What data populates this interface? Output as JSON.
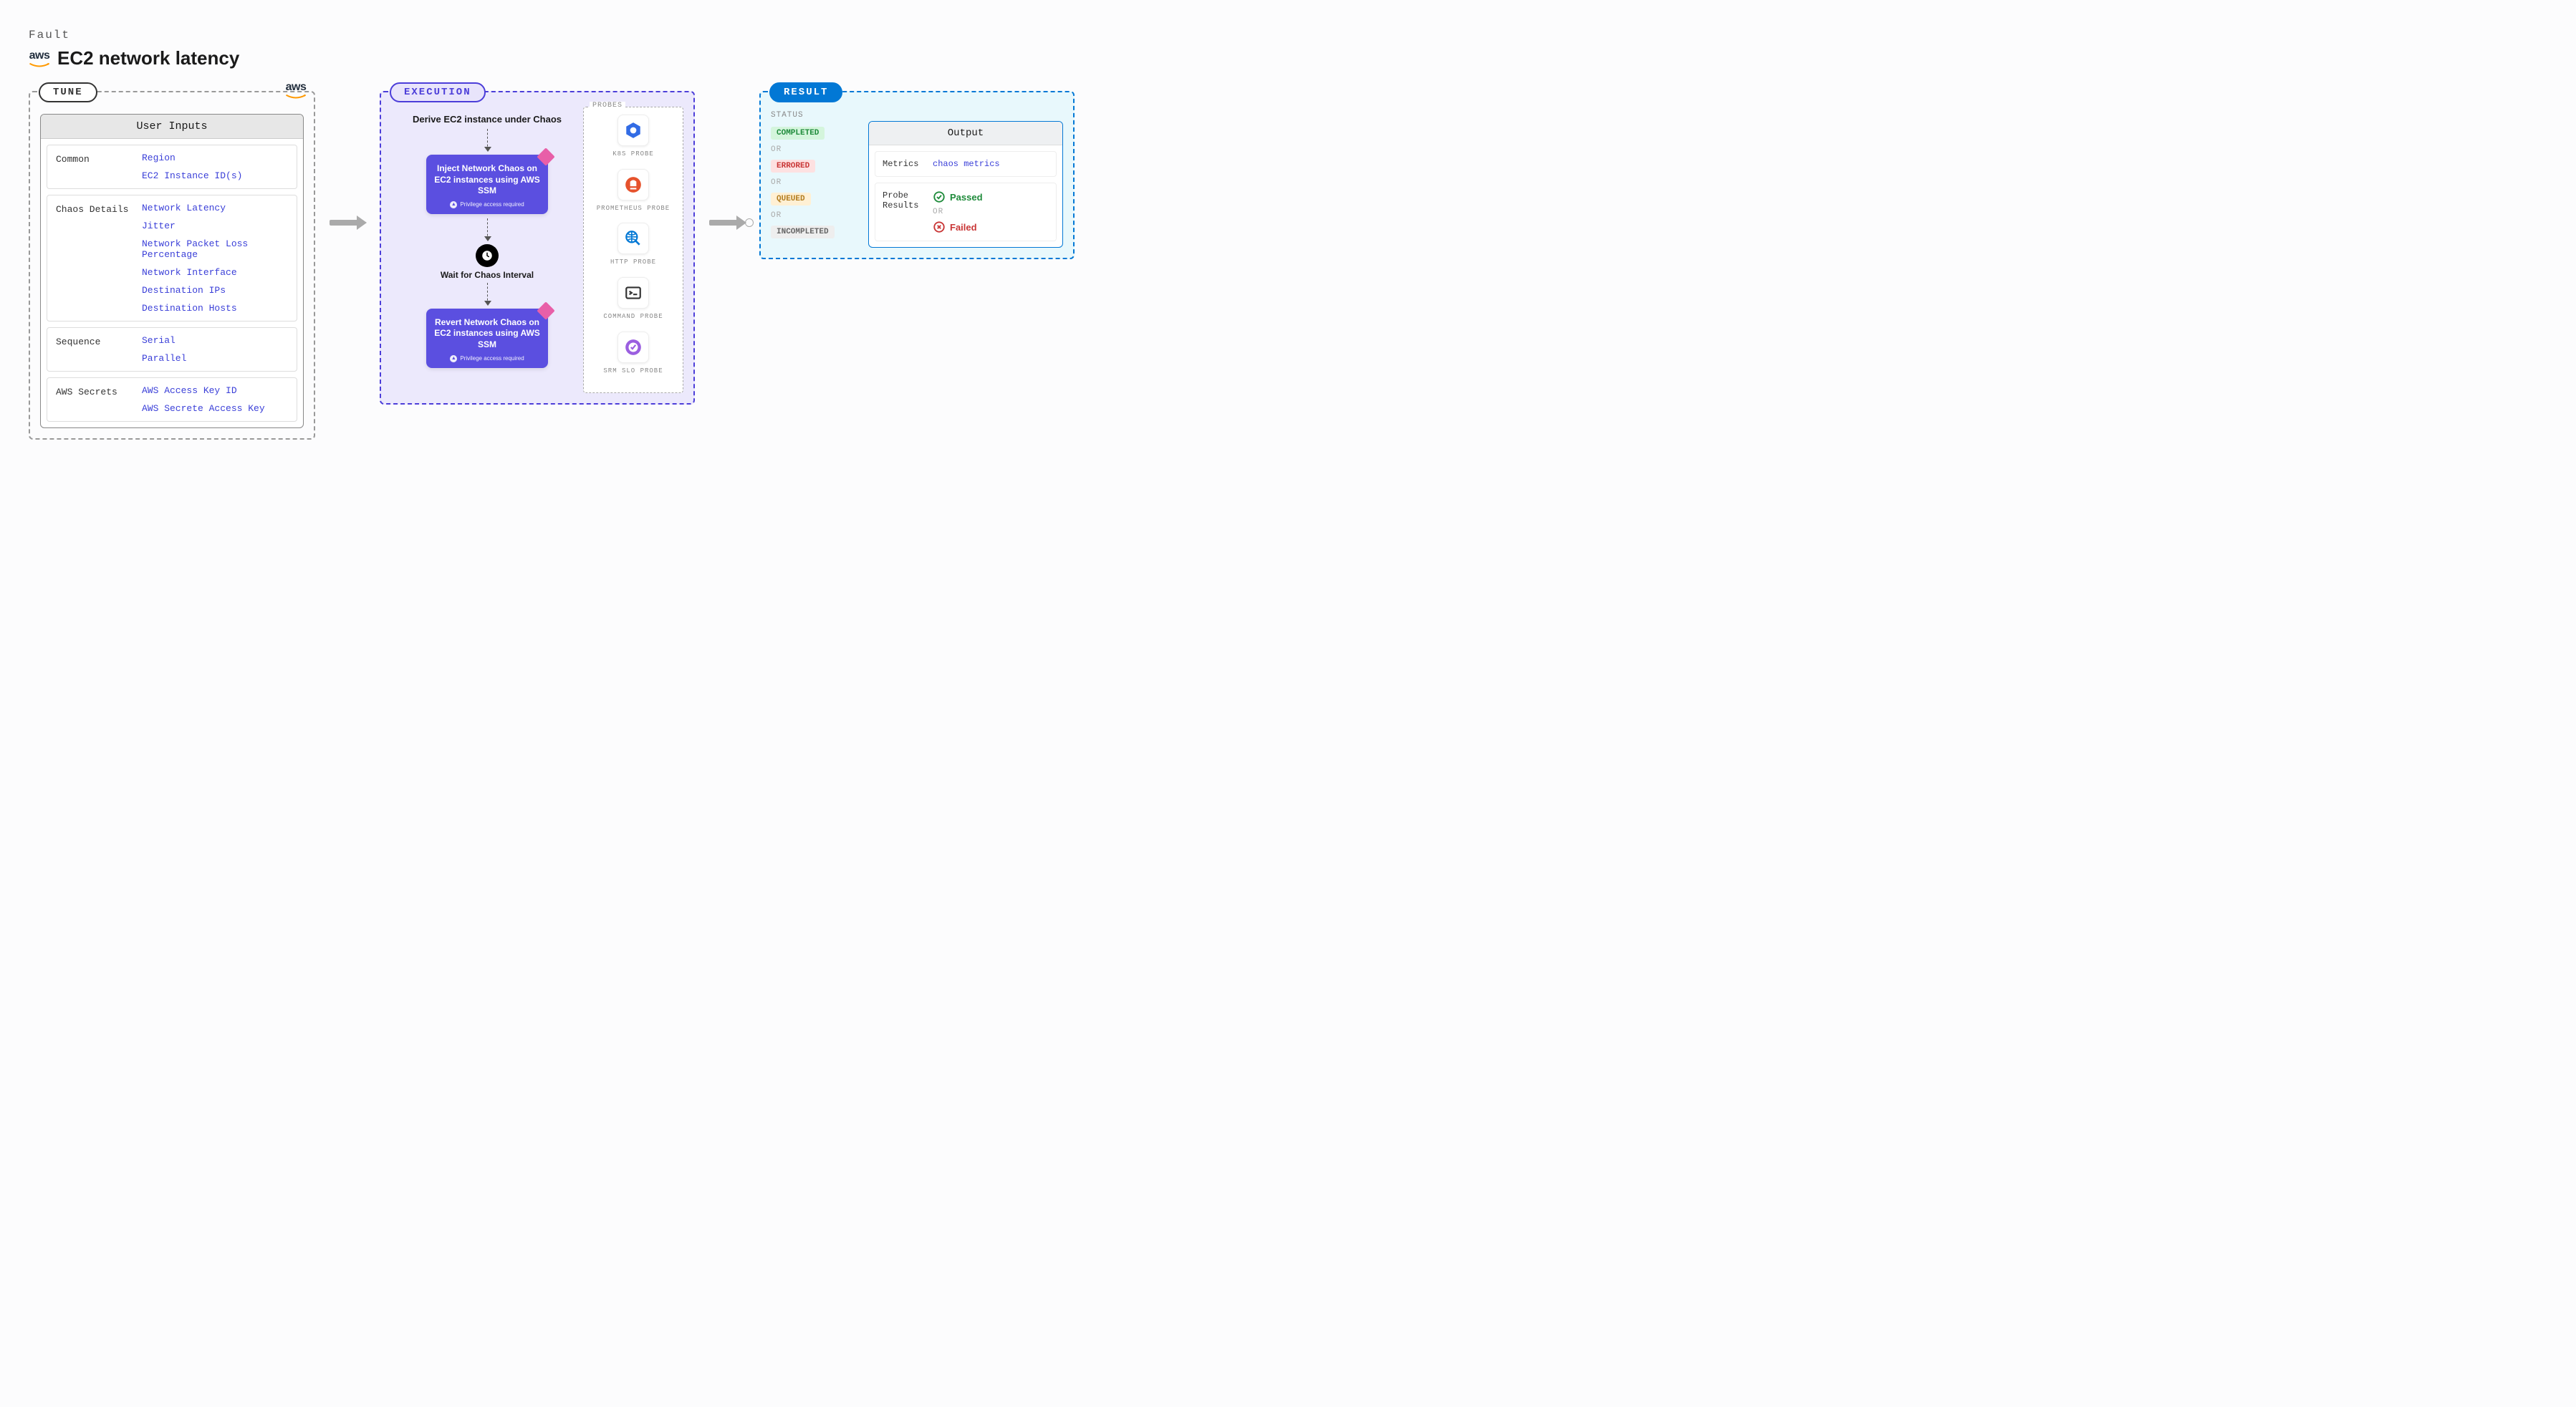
{
  "header": {
    "fault_label": "Fault",
    "aws_text": "aws",
    "title": "EC2 network latency"
  },
  "panels": {
    "tune": {
      "label": "TUNE"
    },
    "exec": {
      "label": "EXECUTION"
    },
    "result": {
      "label": "RESULT"
    }
  },
  "inputs": {
    "header": "User Inputs",
    "sections": [
      {
        "label": "Common",
        "values": [
          "Region",
          "EC2 Instance ID(s)"
        ]
      },
      {
        "label": "Chaos Details",
        "values": [
          "Network Latency",
          "Jitter",
          "Network Packet Loss Percentage",
          "Network Interface",
          "Destination IPs",
          "Destination Hosts"
        ]
      },
      {
        "label": "Sequence",
        "values": [
          "Serial",
          "Parallel"
        ]
      },
      {
        "label": "AWS Secrets",
        "values": [
          "AWS Access Key ID",
          "AWS Secrete Access Key"
        ]
      }
    ]
  },
  "execution": {
    "derive": "Derive EC2 instance under Chaos",
    "step1": "Inject Network Chaos on EC2 instances using AWS SSM",
    "wait": "Wait for Chaos Interval",
    "step2": "Revert Network Chaos on EC2 instances using AWS SSM",
    "priv": "Privilege access required",
    "probes_label": "PROBES",
    "probes": [
      {
        "name": "K8S PROBE",
        "icon": "k8s"
      },
      {
        "name": "PROMETHEUS PROBE",
        "icon": "prom"
      },
      {
        "name": "HTTP PROBE",
        "icon": "http"
      },
      {
        "name": "COMMAND PROBE",
        "icon": "cmd"
      },
      {
        "name": "SRM SLO PROBE",
        "icon": "srm"
      }
    ]
  },
  "result": {
    "status_label": "STATUS",
    "statuses": [
      "COMPLETED",
      "ERRORED",
      "QUEUED",
      "INCOMPLETED"
    ],
    "or": "OR",
    "output_header": "Output",
    "metrics_key": "Metrics",
    "metrics_val": "chaos metrics",
    "probe_results_key": "Probe Results",
    "passed": "Passed",
    "failed": "Failed"
  }
}
